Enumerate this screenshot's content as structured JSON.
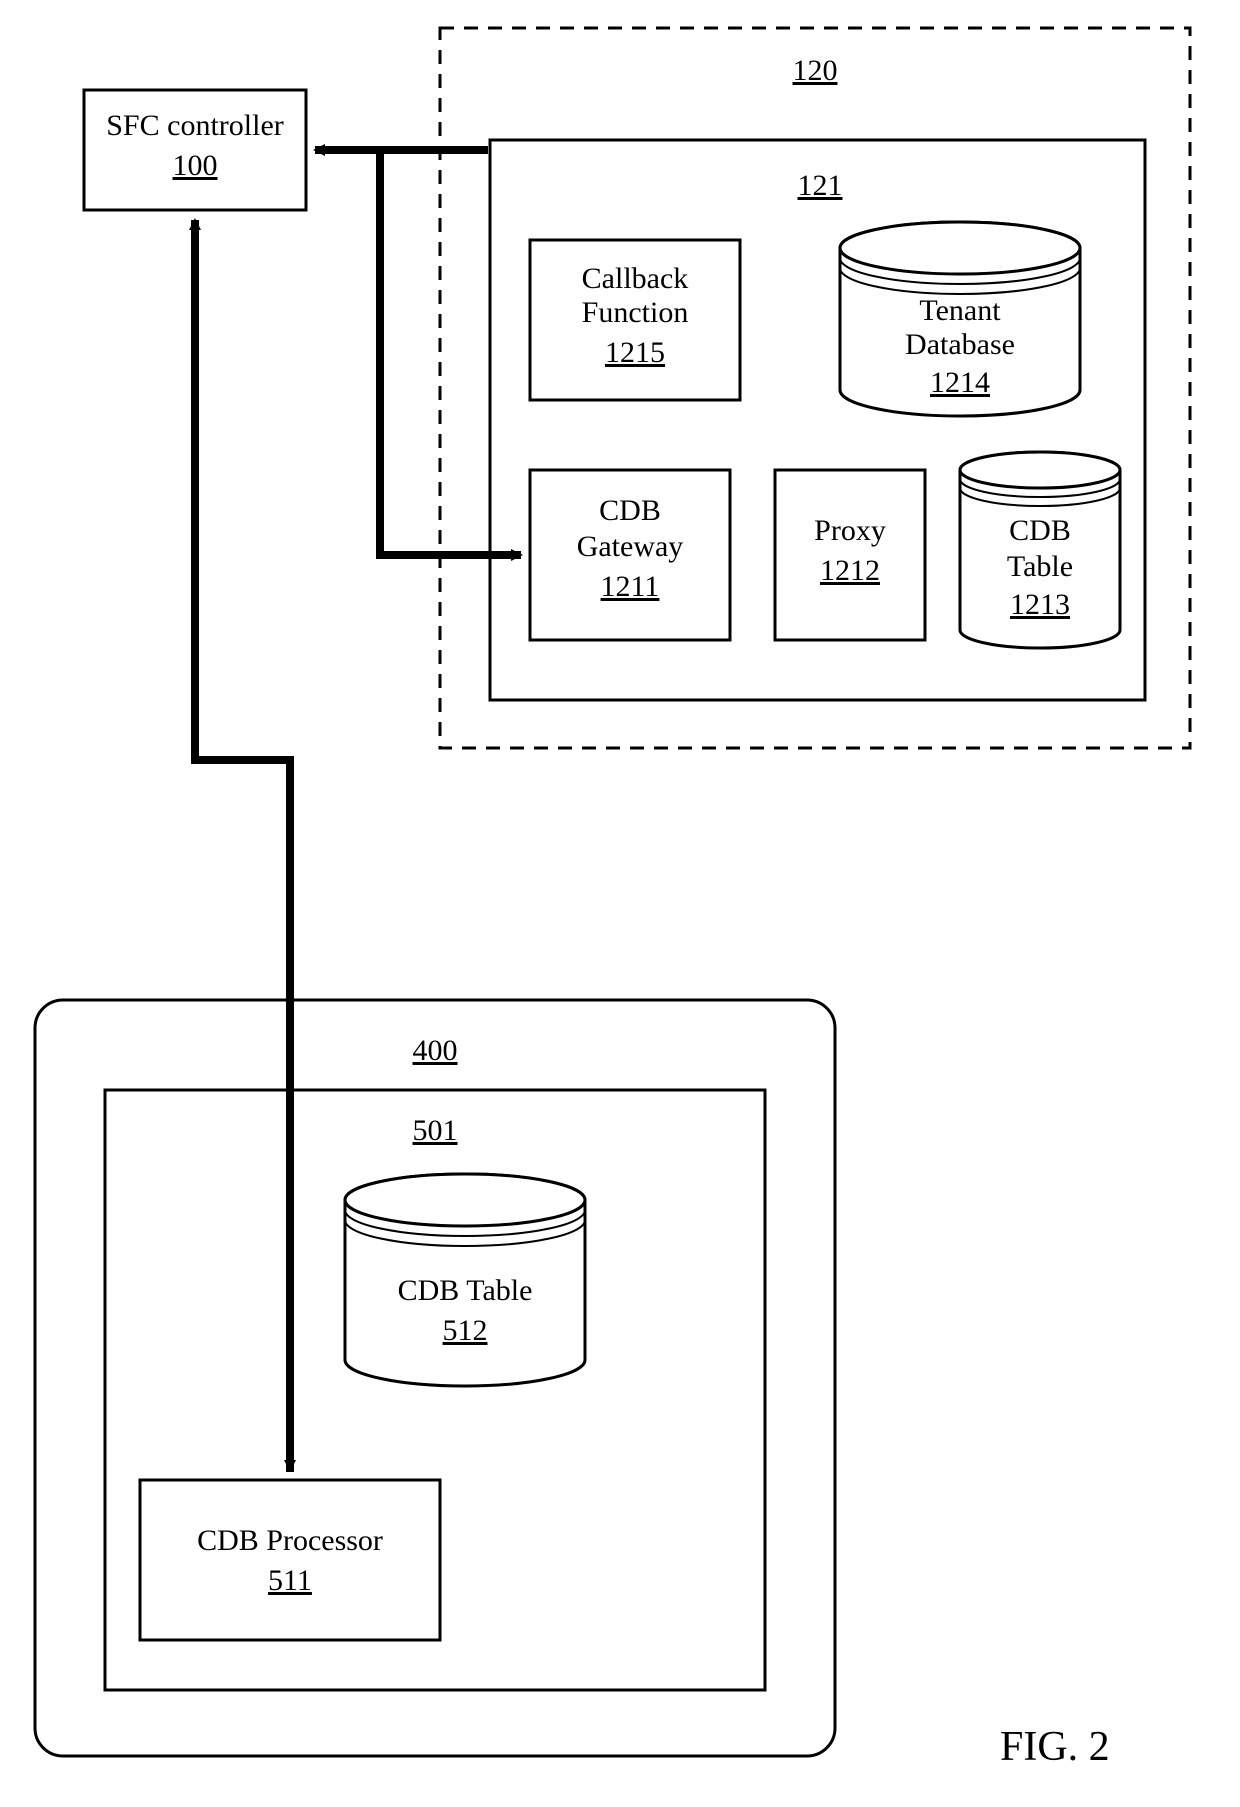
{
  "figure_label": "FIG. 2",
  "sfc": {
    "title": "SFC controller",
    "num": "100"
  },
  "group_120": {
    "num": "120"
  },
  "box_121": {
    "num": "121"
  },
  "callback_fn": {
    "line1": "Callback",
    "line2": "Function",
    "num": "1215"
  },
  "tenant_db": {
    "line1": "Tenant",
    "line2": "Database",
    "num": "1214"
  },
  "cdb_gateway": {
    "line1": "CDB",
    "line2": "Gateway",
    "num": "1211"
  },
  "proxy": {
    "title": "Proxy",
    "num": "1212"
  },
  "cdb_table_121": {
    "line1": "CDB",
    "line2": "Table",
    "num": "1213"
  },
  "group_400": {
    "num": "400"
  },
  "box_501": {
    "num": "501"
  },
  "cdb_table_501": {
    "title": "CDB Table",
    "num": "512"
  },
  "cdb_processor": {
    "title": "CDB Processor",
    "num": "511"
  }
}
